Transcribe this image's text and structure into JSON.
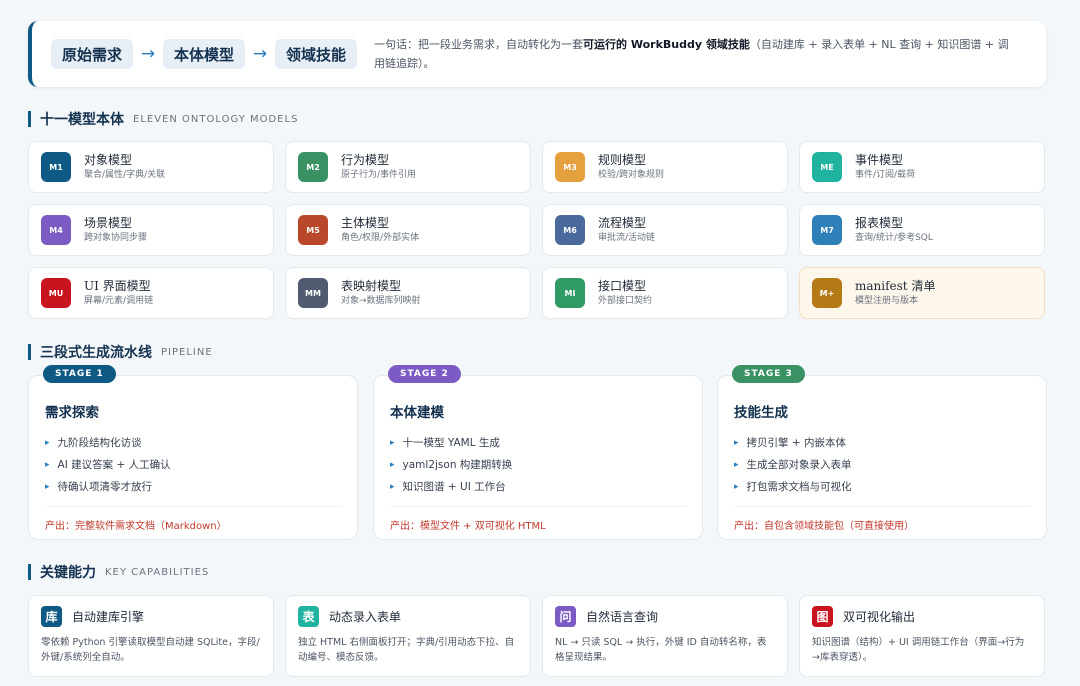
{
  "hero": {
    "flow": [
      "原始需求",
      "本体模型",
      "领域技能"
    ],
    "arrow": "→",
    "tagline_pre": "一句话：把一段业务需求，自动转化为一套",
    "tagline_bold": "可运行的 WorkBuddy 领域技能",
    "tagline_post": "（自动建库 + 录入表单 + NL 查询 + 知识图谱 + 调用链追踪）。"
  },
  "ontology": {
    "title": "十一模型本体",
    "subtitle": "ELEVEN ONTOLOGY MODELS",
    "models": [
      {
        "badge": "M1",
        "name": "对象模型",
        "desc": "聚合/属性/字典/关联",
        "color": "#0f5a85"
      },
      {
        "badge": "M2",
        "name": "行为模型",
        "desc": "原子行为/事件引用",
        "color": "#3a9163"
      },
      {
        "badge": "M3",
        "name": "规则模型",
        "desc": "校验/跨对象规则",
        "color": "#e4a13d"
      },
      {
        "badge": "ME",
        "name": "事件模型",
        "desc": "事件/订阅/载荷",
        "color": "#1fb3a0"
      },
      {
        "badge": "M4",
        "name": "场景模型",
        "desc": "跨对象协同步骤",
        "color": "#7c5cc4"
      },
      {
        "badge": "M5",
        "name": "主体模型",
        "desc": "角色/权限/外部实体",
        "color": "#b9482b"
      },
      {
        "badge": "M6",
        "name": "流程模型",
        "desc": "审批流/活动链",
        "color": "#4a6a9d"
      },
      {
        "badge": "M7",
        "name": "报表模型",
        "desc": "查询/统计/参考SQL",
        "color": "#2f7fb8"
      },
      {
        "badge": "MU",
        "name": "UI 界面模型",
        "desc": "屏幕/元素/调用链",
        "color": "#c8141e"
      },
      {
        "badge": "MM",
        "name": "表映射模型",
        "desc": "对象→数据库列映射",
        "color": "#505b72"
      },
      {
        "badge": "MI",
        "name": "接口模型",
        "desc": "外部接口契约",
        "color": "#2f9a63"
      },
      {
        "badge": "M+",
        "name": "manifest 清单",
        "desc": "模型注册与版本",
        "color": "#b47a16"
      }
    ]
  },
  "pipeline": {
    "title": "三段式生成流水线",
    "subtitle": "PIPELINE",
    "stages": [
      {
        "tag": "STAGE 1",
        "color": "#0f5a85",
        "title": "需求探索",
        "items": [
          "九阶段结构化访谈",
          "AI 建议答案 + 人工确认",
          "待确认项清零才放行"
        ],
        "output": "产出：完整软件需求文档（Markdown）"
      },
      {
        "tag": "STAGE 2",
        "color": "#7c5cc4",
        "title": "本体建模",
        "items": [
          "十一模型 YAML 生成",
          "yaml2json 构建期转换",
          "知识图谱 + UI 工作台"
        ],
        "output": "产出：模型文件 + 双可视化 HTML"
      },
      {
        "tag": "STAGE 3",
        "color": "#3a9163",
        "title": "技能生成",
        "items": [
          "拷贝引擎 + 内嵌本体",
          "生成全部对象录入表单",
          "打包需求文档与可视化"
        ],
        "output": "产出：自包含领域技能包（可直接使用）"
      }
    ]
  },
  "capabilities": {
    "title": "关键能力",
    "subtitle": "KEY CAPABILITIES",
    "items": [
      {
        "icon": "库",
        "title": "自动建库引擎",
        "desc": "零依赖 Python 引擎读取模型自动建 SQLite，字段/外键/系统列全自动。",
        "color": "#0f5a85"
      },
      {
        "icon": "表",
        "title": "动态录入表单",
        "desc": "独立 HTML 右侧面板打开；字典/引用动态下拉、自动编号、模态反馈。",
        "color": "#1fb3a0"
      },
      {
        "icon": "问",
        "title": "自然语言查询",
        "desc": "NL → 只读 SQL → 执行，外键 ID 自动转名称，表格呈现结果。",
        "color": "#7c5cc4"
      },
      {
        "icon": "图",
        "title": "双可视化输出",
        "desc": "知识图谱（结构）+ UI 调用链工作台（界面→行为→库表穿透）。",
        "color": "#c8141e"
      }
    ]
  }
}
